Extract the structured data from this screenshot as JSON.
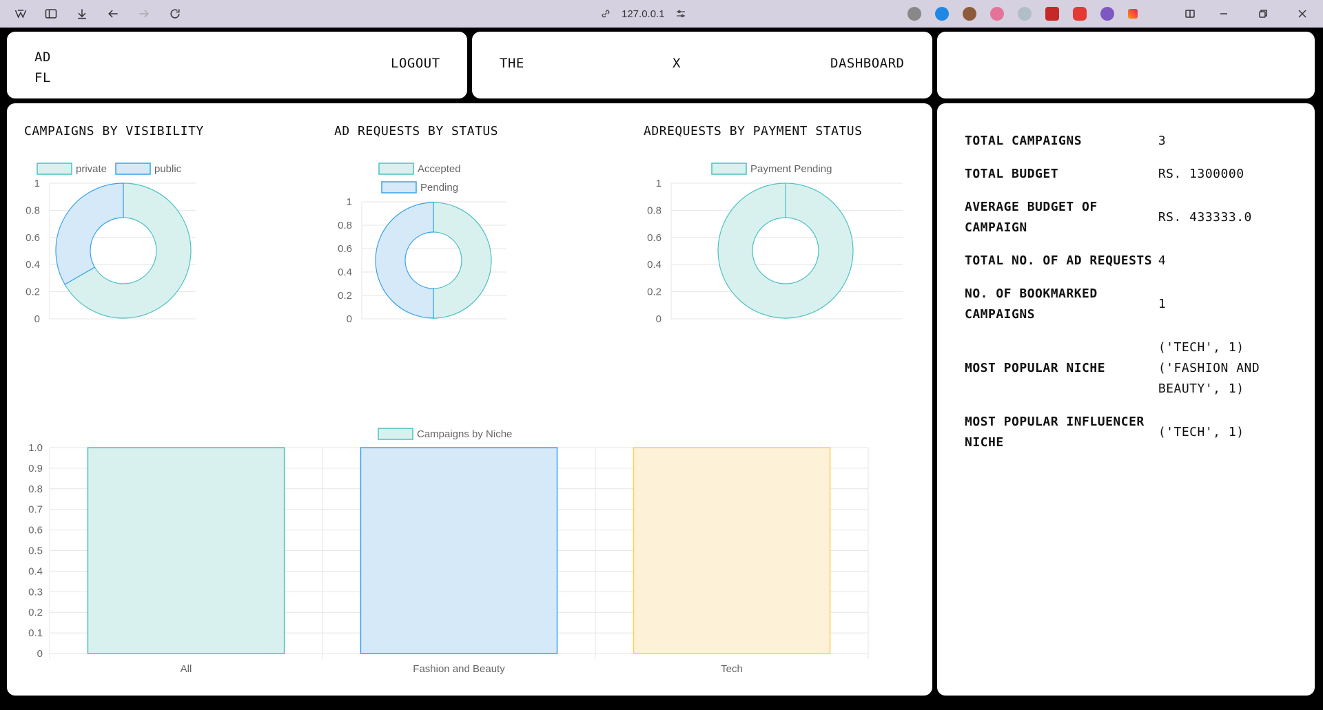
{
  "browser": {
    "url": "127.0.0.1"
  },
  "header": {
    "brand_line1": "AD",
    "brand_line2": "FL",
    "logout": "LOGOUT",
    "nav_the": "THE",
    "nav_x": "X",
    "nav_dashboard": "DASHBOARD"
  },
  "charts_text": {
    "visibility_title": "CAMPAIGNS BY VISIBILITY",
    "status_title": "AD REQUESTS BY STATUS",
    "payment_title": "ADREQUESTS BY PAYMENT STATUS"
  },
  "chart_data": [
    {
      "type": "pie",
      "title": "CAMPAIGNS BY VISIBILITY",
      "categories": [
        "private",
        "public"
      ],
      "values": [
        2,
        1
      ],
      "colors": [
        "#d8f1ef",
        "#d6e9f8"
      ],
      "border_colors": [
        "#4bc0c0",
        "#36a2eb"
      ],
      "yticks": [
        "0",
        "0.2",
        "0.4",
        "0.6",
        "0.8",
        "1"
      ]
    },
    {
      "type": "pie",
      "title": "AD REQUESTS BY STATUS",
      "categories": [
        "Accepted",
        "Pending"
      ],
      "values": [
        2,
        2
      ],
      "colors": [
        "#d8f1ef",
        "#d6e9f8"
      ],
      "border_colors": [
        "#4bc0c0",
        "#36a2eb"
      ],
      "yticks": [
        "0",
        "0.2",
        "0.4",
        "0.6",
        "0.8",
        "1"
      ]
    },
    {
      "type": "pie",
      "title": "ADREQUESTS BY PAYMENT STATUS",
      "categories": [
        "Payment Pending"
      ],
      "values": [
        1
      ],
      "colors": [
        "#d8f1ef"
      ],
      "border_colors": [
        "#4bc0c0"
      ],
      "yticks": [
        "0",
        "0.2",
        "0.4",
        "0.6",
        "0.8",
        "1"
      ]
    },
    {
      "type": "bar",
      "series": [
        {
          "name": "Campaigns by Niche",
          "values": [
            1,
            1,
            1
          ]
        }
      ],
      "categories": [
        "All",
        "Fashion and Beauty",
        "Tech"
      ],
      "colors": [
        "#d8f1ef",
        "#d6e9f8",
        "#fdf1d8"
      ],
      "border_colors": [
        "#4bc0c0",
        "#36a2eb",
        "#ffcd56"
      ],
      "ylim": [
        0,
        1.0
      ],
      "yticks": [
        "0",
        "0.1",
        "0.2",
        "0.3",
        "0.4",
        "0.5",
        "0.6",
        "0.7",
        "0.8",
        "0.9",
        "1.0"
      ]
    }
  ],
  "stats": [
    {
      "label": "TOTAL CAMPAIGNS",
      "value": "3"
    },
    {
      "label": "TOTAL BUDGET",
      "value": "RS. 1300000"
    },
    {
      "label": "AVERAGE BUDGET OF CAMPAIGN",
      "value": "RS. 433333.0"
    },
    {
      "label": "TOTAL NO. OF AD REQUESTS",
      "value": "4"
    },
    {
      "label": "NO. OF BOOKMARKED CAMPAIGNS",
      "value": "1"
    },
    {
      "label": "MOST POPULAR NICHE",
      "value": "('TECH', 1) ('FASHION AND BEAUTY', 1)"
    },
    {
      "label": "MOST POPULAR INFLUENCER NICHE",
      "value": "('TECH', 1)"
    }
  ]
}
